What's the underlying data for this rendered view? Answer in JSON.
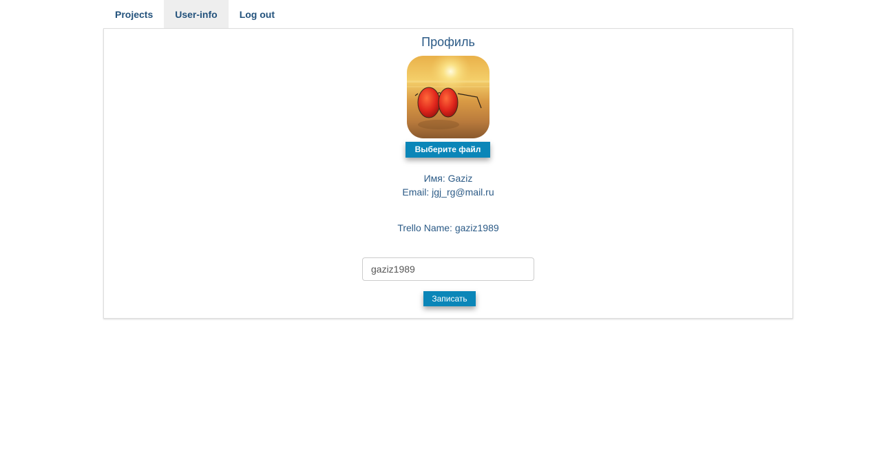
{
  "nav": {
    "tabs": [
      {
        "label": "Projects"
      },
      {
        "label": "User-info"
      },
      {
        "label": "Log out"
      }
    ],
    "active_tab": "User-info"
  },
  "profile": {
    "title": "Профиль",
    "avatar_description_icon": "sunglasses-on-beach-photo",
    "choose_file_label": "Выберите файл",
    "name_line": "Имя: Gaziz",
    "email_line": "Email: jgj_rg@mail.ru",
    "trello_line": "Trello Name: gaziz1989",
    "trello_input_value": "gaziz1989",
    "save_label": "Записать"
  },
  "colors": {
    "link": "#23527c",
    "text": "#2b5a86",
    "button": "#0b86b8",
    "active_tab_bg": "#eeeeee"
  }
}
